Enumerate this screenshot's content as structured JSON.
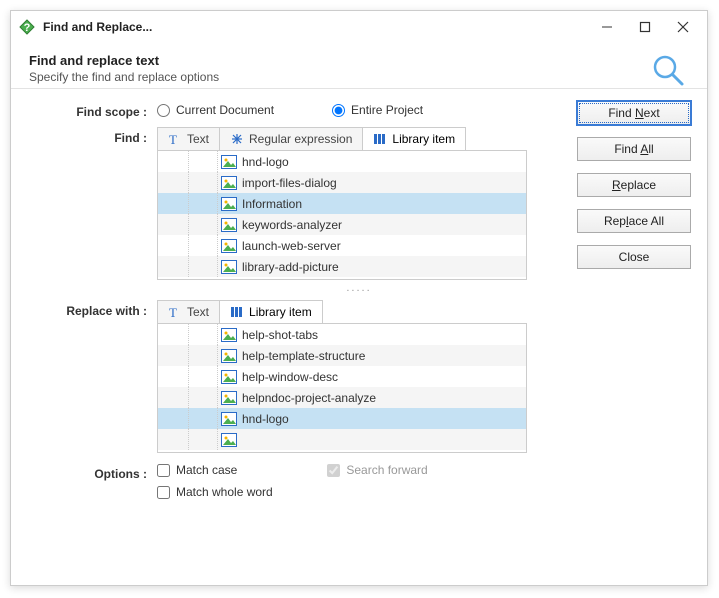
{
  "title": "Find and Replace...",
  "header": {
    "main": "Find and replace text",
    "sub": "Specify the find and replace options"
  },
  "labels": {
    "find_scope": "Find scope :",
    "find": "Find :",
    "replace_with": "Replace with :",
    "options": "Options :"
  },
  "scope": {
    "current_doc": "Current Document",
    "entire_project": "Entire Project"
  },
  "tabs_find": {
    "text": "Text",
    "regex": "Regular expression",
    "library": "Library item"
  },
  "tabs_replace": {
    "text": "Text",
    "library": "Library item"
  },
  "find_items": [
    "hnd-logo",
    "import-files-dialog",
    "Information",
    "keywords-analyzer",
    "launch-web-server",
    "library-add-picture"
  ],
  "find_selected_index": 2,
  "replace_items": [
    "help-shot-tabs",
    "help-template-structure",
    "help-window-desc",
    "helpndoc-project-analyze",
    "hnd-logo",
    " "
  ],
  "replace_selected_index": 4,
  "buttons": {
    "find_next_pre": "Find ",
    "find_next_u": "N",
    "find_next_post": "ext",
    "find_all_pre": "Find ",
    "find_all_u": "A",
    "find_all_post": "ll",
    "replace_u": "R",
    "replace_post": "eplace",
    "replace_all_pre": "Rep",
    "replace_all_u": "l",
    "replace_all_post": "ace All",
    "close": "Close"
  },
  "options": {
    "match_case": "Match case",
    "match_whole": "Match whole word",
    "search_forward": "Search forward"
  },
  "ellipsis": "....."
}
